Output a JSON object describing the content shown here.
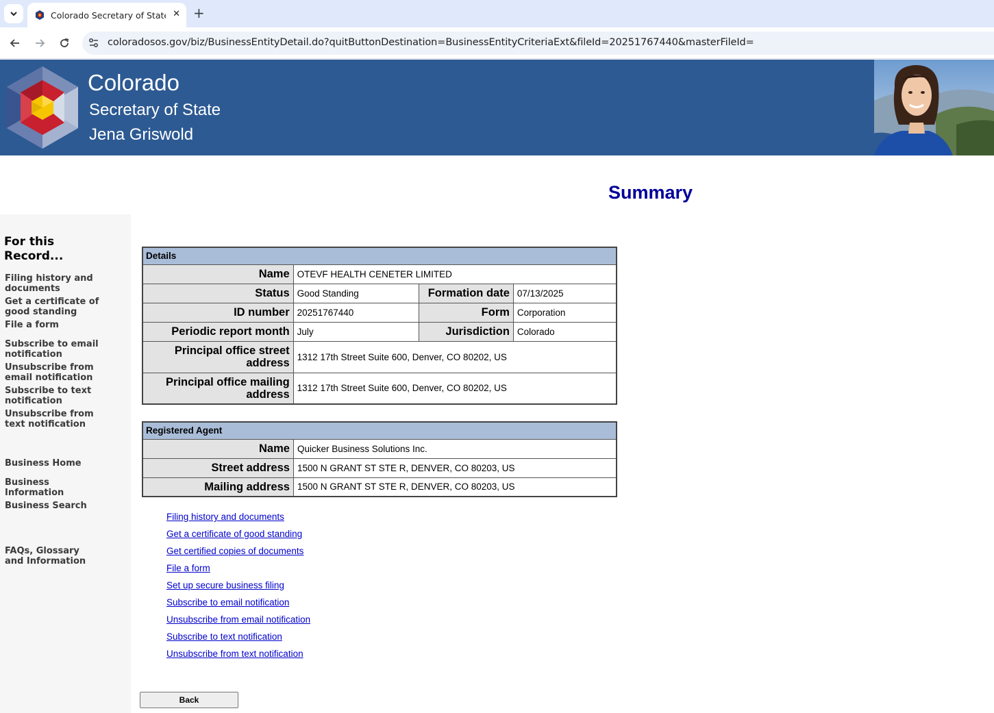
{
  "browser": {
    "tab_title": "Colorado Secretary of State -",
    "url": "coloradosos.gov/biz/BusinessEntityDetail.do?quitButtonDestination=BusinessEntityCriteriaExt&fileId=20251767440&masterFileId="
  },
  "banner": {
    "line1": "Colorado",
    "line2": "Secretary of State",
    "line3": "Jena Griswold"
  },
  "page_title": "Summary",
  "sidebar": {
    "heading": "For this Record...",
    "items": [
      "Filing history and documents",
      "Get a certificate of good standing",
      "File a form",
      "Subscribe to email notification",
      "Unsubscribe from email notification",
      "Subscribe to text notification",
      "Unsubscribe from text notification",
      "Business Home",
      "Business Information",
      "Business Search",
      "FAQs, Glossary and Information"
    ]
  },
  "details": {
    "header": "Details",
    "name_label": "Name",
    "name": "OTEVF HEALTH CENETER LIMITED",
    "status_label": "Status",
    "status": "Good Standing",
    "formation_label": "Formation date",
    "formation": "07/13/2025",
    "id_label": "ID number",
    "id": "20251767440",
    "form_label": "Form",
    "form": "Corporation",
    "periodic_label": "Periodic report month",
    "periodic": "July",
    "jurisdiction_label": "Jurisdiction",
    "jurisdiction": "Colorado",
    "street_label": "Principal office street address",
    "street": "1312 17th Street Suite 600, Denver, CO 80202, US",
    "mailing_label": "Principal office mailing address",
    "mailing": "1312 17th Street Suite 600, Denver, CO 80202, US"
  },
  "agent": {
    "header": "Registered Agent",
    "name_label": "Name",
    "name": "Quicker Business Solutions Inc.",
    "street_label": "Street address",
    "street": "1500 N GRANT ST STE R, DENVER, CO 80203, US",
    "mailing_label": "Mailing address",
    "mailing": "1500 N GRANT ST STE R, DENVER, CO 80203, US"
  },
  "links": [
    "Filing history and documents",
    "Get a certificate of good standing",
    "Get certified copies of documents",
    "File a form",
    "Set up secure business filing",
    "Subscribe to email notification",
    "Unsubscribe from email notification",
    "Subscribe to text notification",
    "Unsubscribe from text notification"
  ],
  "back_label": "Back",
  "colors": {
    "banner": "#2d5a93",
    "table_header": "#a9bdd8",
    "title": "#000099",
    "link": "#0000cc"
  }
}
